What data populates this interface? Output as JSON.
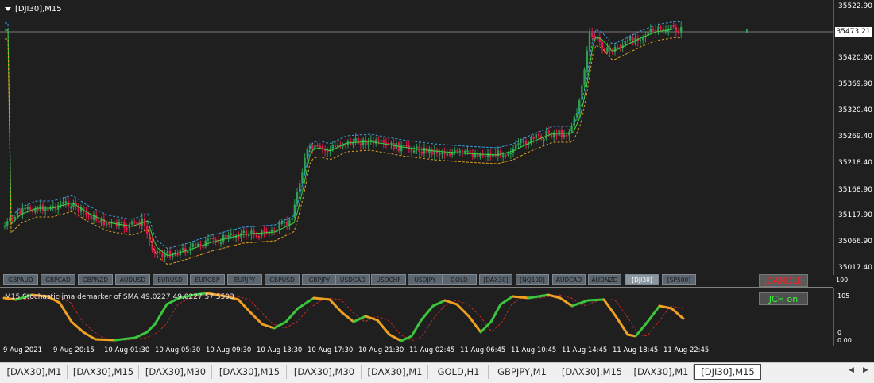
{
  "chart": {
    "title": "[DJI30],M15",
    "current_price": "35473.21",
    "price_labels": [
      "35522.90",
      "35473.21",
      "35420.90",
      "35369.90",
      "35320.40",
      "35269.40",
      "35218.40",
      "35168.90",
      "35117.90",
      "35066.90",
      "35017.40"
    ],
    "colors": {
      "background": "#1f1f1f",
      "bull": "#2e9e55",
      "bear": "#e0194a",
      "ma_main": "#3cd43c",
      "band_upper": "#3aa0e0",
      "band_lower": "#e0a020",
      "stoch_up": "#3cc43c",
      "stoch_down": "#f0a020",
      "signal": "#c82828"
    }
  },
  "symbol_buttons": [
    "GBPAUD",
    "GBPCAD",
    "GBPNZD",
    "AUDUSD",
    "EURUSD",
    "EURGBP",
    "EURJPY",
    "GBPUSD",
    "GBPJPY",
    "USDCAD",
    "USDCHF",
    "USDJPY",
    "GOLD",
    "[DAX30]",
    "[NQ100]",
    "AUDCAD",
    "AUDNZD",
    "[DJI30]",
    "[SP500]"
  ],
  "active_symbol": "[DJI30]",
  "indicator_buttons": {
    "jcandle": "JCANDLE",
    "jch": "JCH on"
  },
  "subwindow": {
    "title": "M15 Stochastic jma demarker of SMA 49.0227 49.0227 57.5593",
    "scale_labels": [
      "100",
      "105",
      "0",
      "0.00"
    ]
  },
  "time_labels": [
    "9 Aug 2021",
    "9 Aug 20:15",
    "10 Aug 01:30",
    "10 Aug 05:30",
    "10 Aug 09:30",
    "10 Aug 13:30",
    "10 Aug 17:30",
    "10 Aug 21:30",
    "11 Aug 02:45",
    "11 Aug 06:45",
    "11 Aug 10:45",
    "11 Aug 14:45",
    "11 Aug 18:45",
    "11 Aug 22:45"
  ],
  "tabs": [
    "[DAX30],M1",
    "[DAX30],M15",
    "[DAX30],M30",
    "[DAX30],M15",
    "[DAX30],M30",
    "[DAX30],M1",
    "GOLD,H1",
    "GBPJPY,M1",
    "[DAX30],M15",
    "[DAX30],M1",
    "[DJI30],M15"
  ],
  "active_tab_index": 10
}
